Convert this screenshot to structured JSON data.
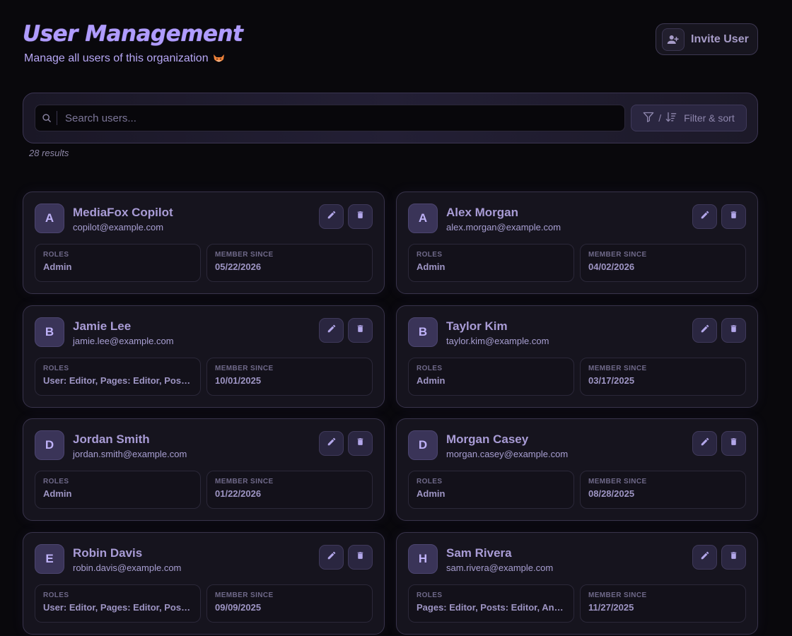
{
  "header": {
    "title": "User Management",
    "subtitle": "Manage all users of this organization",
    "invite_label": "Invite User"
  },
  "search": {
    "placeholder": "Search users...",
    "value": "",
    "filter_label": "Filter & sort",
    "filter_separator": "/"
  },
  "results": {
    "count_text": "28 results"
  },
  "labels": {
    "roles": "ROLES",
    "member_since": "MEMBER SINCE"
  },
  "users": [
    {
      "initial": "A",
      "name": "MediaFox Copilot",
      "email": "copilot@example.com",
      "roles": "Admin",
      "member_since": "05/22/2026"
    },
    {
      "initial": "A",
      "name": "Alex Morgan",
      "email": "alex.morgan@example.com",
      "roles": "Admin",
      "member_since": "04/02/2026"
    },
    {
      "initial": "B",
      "name": "Jamie Lee",
      "email": "jamie.lee@example.com",
      "roles": "User: Editor, Pages: Editor, Posts: Editor",
      "member_since": "10/01/2025"
    },
    {
      "initial": "B",
      "name": "Taylor Kim",
      "email": "taylor.kim@example.com",
      "roles": "Admin",
      "member_since": "03/17/2025"
    },
    {
      "initial": "D",
      "name": "Jordan Smith",
      "email": "jordan.smith@example.com",
      "roles": "Admin",
      "member_since": "01/22/2026"
    },
    {
      "initial": "D",
      "name": "Morgan Casey",
      "email": "morgan.casey@example.com",
      "roles": "Admin",
      "member_since": "08/28/2025"
    },
    {
      "initial": "E",
      "name": "Robin Davis",
      "email": "robin.davis@example.com",
      "roles": "User: Editor, Pages: Editor, Posts: Editor",
      "member_since": "09/09/2025"
    },
    {
      "initial": "H",
      "name": "Sam Rivera",
      "email": "sam.rivera@example.com",
      "roles": "Pages: Editor, Posts: Editor, Analytics: Viewer",
      "member_since": "11/27/2025"
    }
  ],
  "icons": {
    "invite": "person-add-icon",
    "subtitle": "fox-icon",
    "search": "search-icon",
    "filter": "filter-icon",
    "sort": "sort-icon",
    "edit": "pencil-icon",
    "delete": "trash-icon"
  },
  "colors": {
    "accent": "#b09cff",
    "background": "#09080c",
    "card": "#16141e"
  }
}
